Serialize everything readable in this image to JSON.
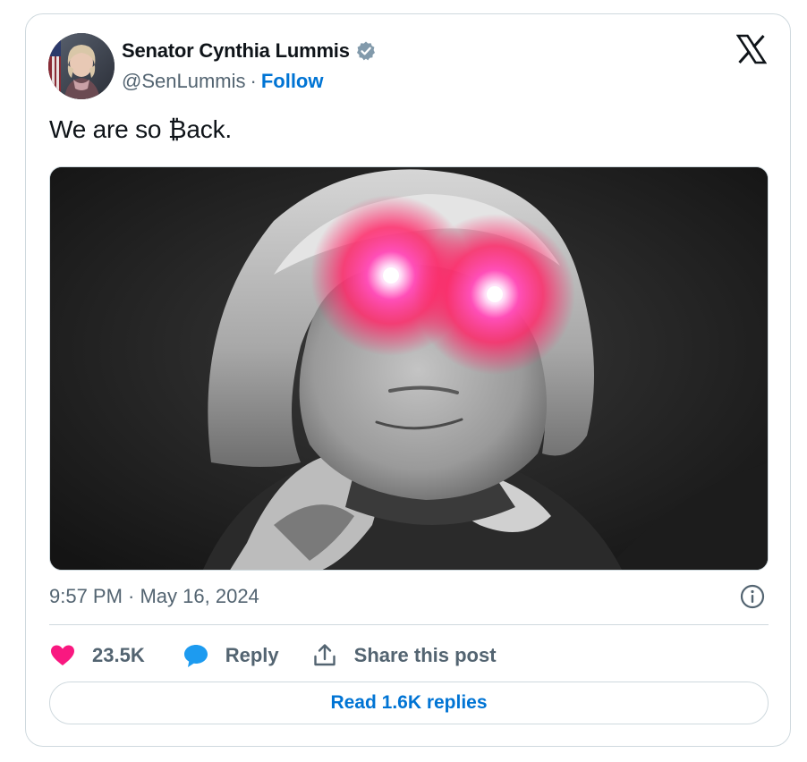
{
  "author": {
    "display_name": "Senator Cynthia Lummis",
    "handle": "@SenLummis",
    "separator": "·",
    "follow_label": "Follow",
    "verified": true
  },
  "post": {
    "text": "We are so ₿ack.",
    "timestamp": "9:57 PM · May 16, 2024"
  },
  "actions": {
    "like_count": "23.5K",
    "reply_label": "Reply",
    "share_label": "Share this post"
  },
  "footer": {
    "read_replies_label": "Read 1.6K replies"
  },
  "colors": {
    "accent": "#0074d4",
    "like": "#f91880",
    "reply_icon": "#1d9bf0",
    "secondary_text": "#536471",
    "border": "#cfd9de",
    "verified_badge": "#829aab"
  },
  "icons": {
    "platform": "x-logo-icon",
    "verified": "verified-badge-icon",
    "info": "info-icon",
    "like": "heart-icon",
    "reply": "speech-bubble-icon",
    "share": "share-upload-icon"
  }
}
